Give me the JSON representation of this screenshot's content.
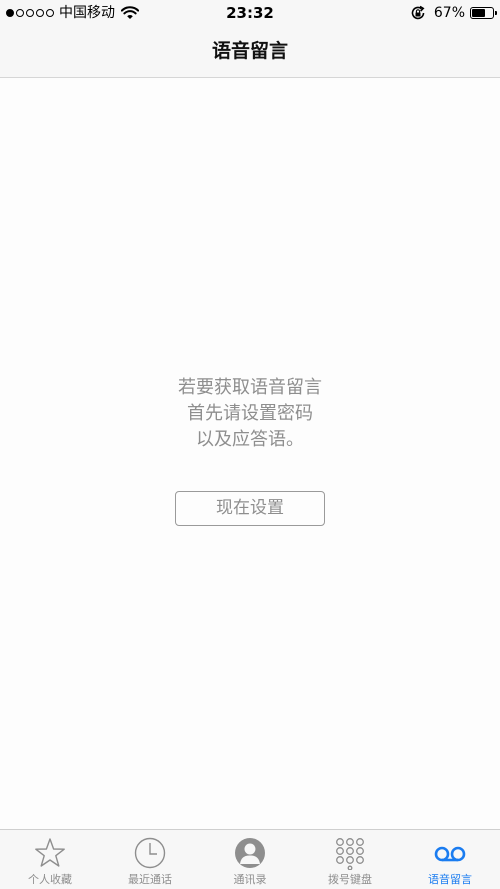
{
  "status_bar": {
    "signal_filled": 1,
    "signal_total": 5,
    "carrier": "中国移动",
    "time": "23:32",
    "battery_percent": "67%",
    "battery_level": 0.67
  },
  "nav": {
    "title": "语音留言"
  },
  "empty_state": {
    "line1": "若要获取语音留言",
    "line2": "首先请设置密码",
    "line3": "以及应答语。",
    "setup_button": "现在设置"
  },
  "tab_bar": {
    "tabs": [
      {
        "label": "个人收藏",
        "icon": "star-icon",
        "active": false
      },
      {
        "label": "最近通话",
        "icon": "clock-icon",
        "active": false
      },
      {
        "label": "通讯录",
        "icon": "contact-icon",
        "active": false
      },
      {
        "label": "拨号键盘",
        "icon": "keypad-icon",
        "active": false
      },
      {
        "label": "语音留言",
        "icon": "voicemail-icon",
        "active": true
      }
    ],
    "inactive_color": "#8e8e8e",
    "active_color": "#1a7cf0"
  }
}
